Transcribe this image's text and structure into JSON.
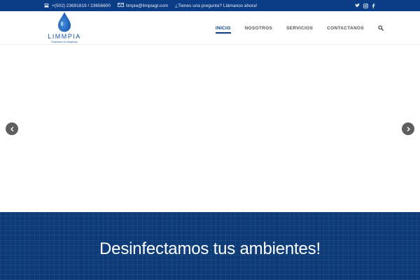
{
  "topbar": {
    "phone": "+(502) 23691819 / 23656600",
    "email": "limpia@limpiagt.com",
    "cta": "¿Tienes una pregunta? Llámanos ahora!",
    "social": [
      "twitter-icon",
      "instagram-icon",
      "facebook-icon"
    ]
  },
  "logo": {
    "brand": "LIMMPIA",
    "tagline": "Expertos en limpieza"
  },
  "nav": {
    "items": [
      "INICIO",
      "NOSOTROS",
      "SERVICIOS",
      "CONTACTANOS"
    ],
    "active": "INICIO",
    "search_icon": "search-icon"
  },
  "slider": {
    "prev_icon": "chevron-left-icon",
    "next_icon": "chevron-right-icon"
  },
  "banner": {
    "headline": "Desinfectamos tus ambientes!"
  },
  "colors": {
    "primary": "#0a3d85",
    "banner": "#0d3b78",
    "nav_text": "#555555",
    "arrow": "#5f5f5f"
  }
}
